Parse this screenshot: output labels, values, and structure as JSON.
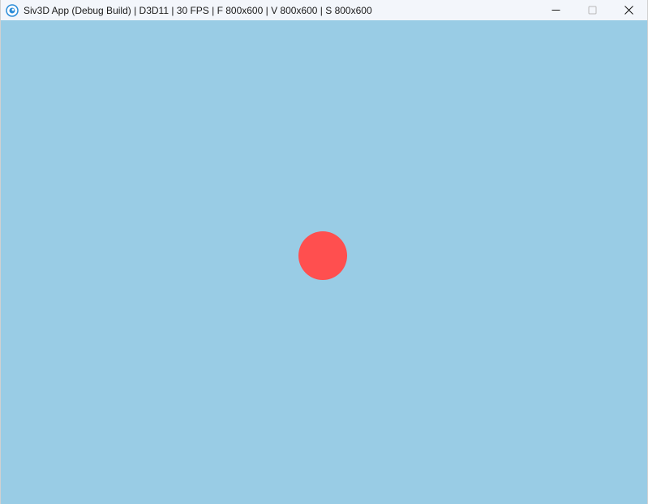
{
  "window": {
    "title": "Siv3D App (Debug Build) | D3D11 | 30 FPS | F 800x600 | V 800x600 | S 800x600",
    "icon": "siv3d-app-icon",
    "controls": {
      "minimize_icon": "minimize-icon",
      "maximize_icon": "maximize-icon",
      "close_icon": "close-icon"
    }
  },
  "scene": {
    "background_color": "#99cce5",
    "circle_color": "#ff4f4f",
    "circle_count": 1
  }
}
